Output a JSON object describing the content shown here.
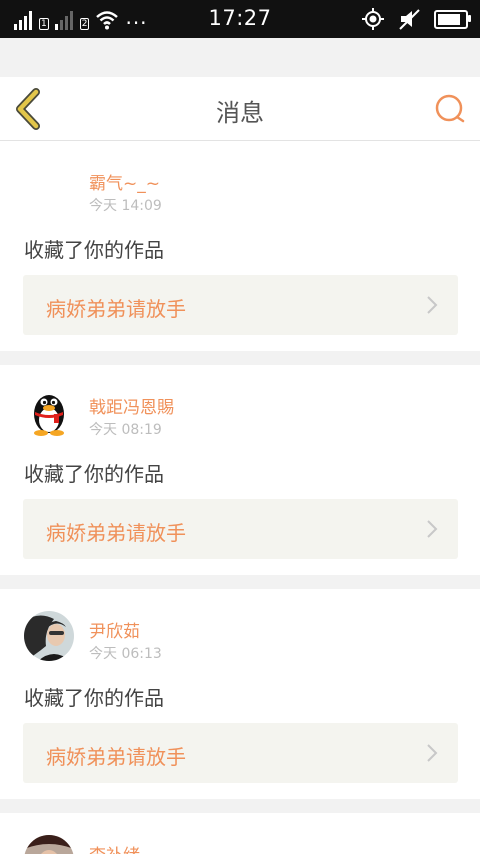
{
  "status_bar": {
    "time": "17:27",
    "sim1": "1",
    "sim2": "2",
    "more": "···"
  },
  "header": {
    "title": "消息",
    "back_icon": "chevron-left-icon",
    "search_icon": "search-icon"
  },
  "colors": {
    "accent": "#f0915a",
    "back_icon": "#e2c64a",
    "text": "#444444",
    "muted": "#bdbdbd",
    "card_inner": "#f4f4ef"
  },
  "messages": [
    {
      "user": "霸气~_~",
      "time": "今天 14:09",
      "action": "收藏了你的作品",
      "work": "病娇弟弟请放手",
      "avatar": "blank-avatar"
    },
    {
      "user": "戟距冯恩賜",
      "time": "今天 08:19",
      "action": "收藏了你的作品",
      "work": "病娇弟弟请放手",
      "avatar": "qq-penguin-avatar"
    },
    {
      "user": "尹欣茹",
      "time": "今天 06:13",
      "action": "收藏了你的作品",
      "work": "病娇弟弟请放手",
      "avatar": "photo-avatar"
    },
    {
      "user": "李补绪",
      "avatar": "photo-avatar"
    }
  ]
}
